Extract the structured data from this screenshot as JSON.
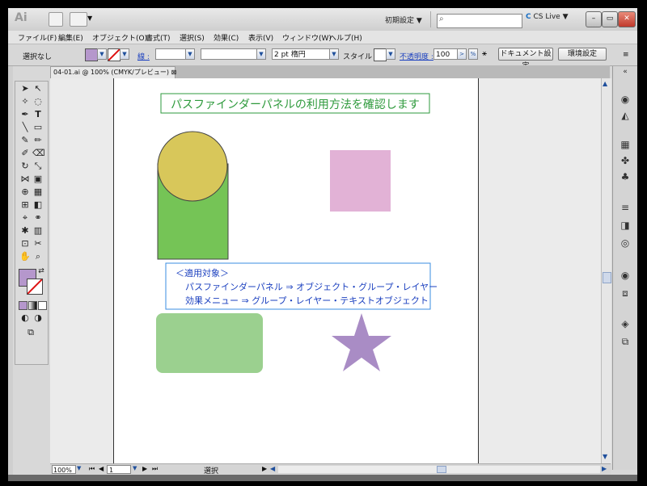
{
  "app": {
    "logo": "Ai",
    "workspace": "初期設定",
    "cs_live": "CS Live",
    "search_placeholder": ""
  },
  "menu": [
    "ファイル(F)",
    "編集(E)",
    "オブジェクト(O)",
    "書式(T)",
    "選択(S)",
    "効果(C)",
    "表示(V)",
    "ウィンドウ(W)",
    "ヘルプ(H)"
  ],
  "control": {
    "selection_label": "選択なし",
    "stroke_label": "線 :",
    "stroke_value": "",
    "stroke_weight": "2 pt 楕円",
    "style_label": "スタイル :",
    "opacity_label": "不透明度 :",
    "opacity_value": "100",
    "doc_setup_button": "ドキュメント設定",
    "prefs_button": "環境設定"
  },
  "doc_tab": {
    "title": "04-01.ai @ 100% (CMYK/プレビュー)",
    "close": "⊠"
  },
  "artwork": {
    "heading": "パスファインダーパネルの利用方法を確認します",
    "info_line1": "＜適用対象＞",
    "info_line2": "パスファインダーパネル ⇒ オブジェクト・グループ・レイヤー",
    "info_line3": "効果メニュー ⇒ グループ・レイヤー・テキストオブジェクト"
  },
  "status": {
    "zoom": "100%",
    "page": "1",
    "tool": "選択"
  },
  "colors": {
    "heading_green": "#2e9a3c",
    "info_blue": "#1a3fbf",
    "circle_fill": "#d8c75a",
    "rect_green": "#75c456",
    "pink_square": "#e2b2d6",
    "rounded_green": "#9bd08f",
    "star_purple": "#a98cc5",
    "fill_swatch": "#b597cc"
  }
}
